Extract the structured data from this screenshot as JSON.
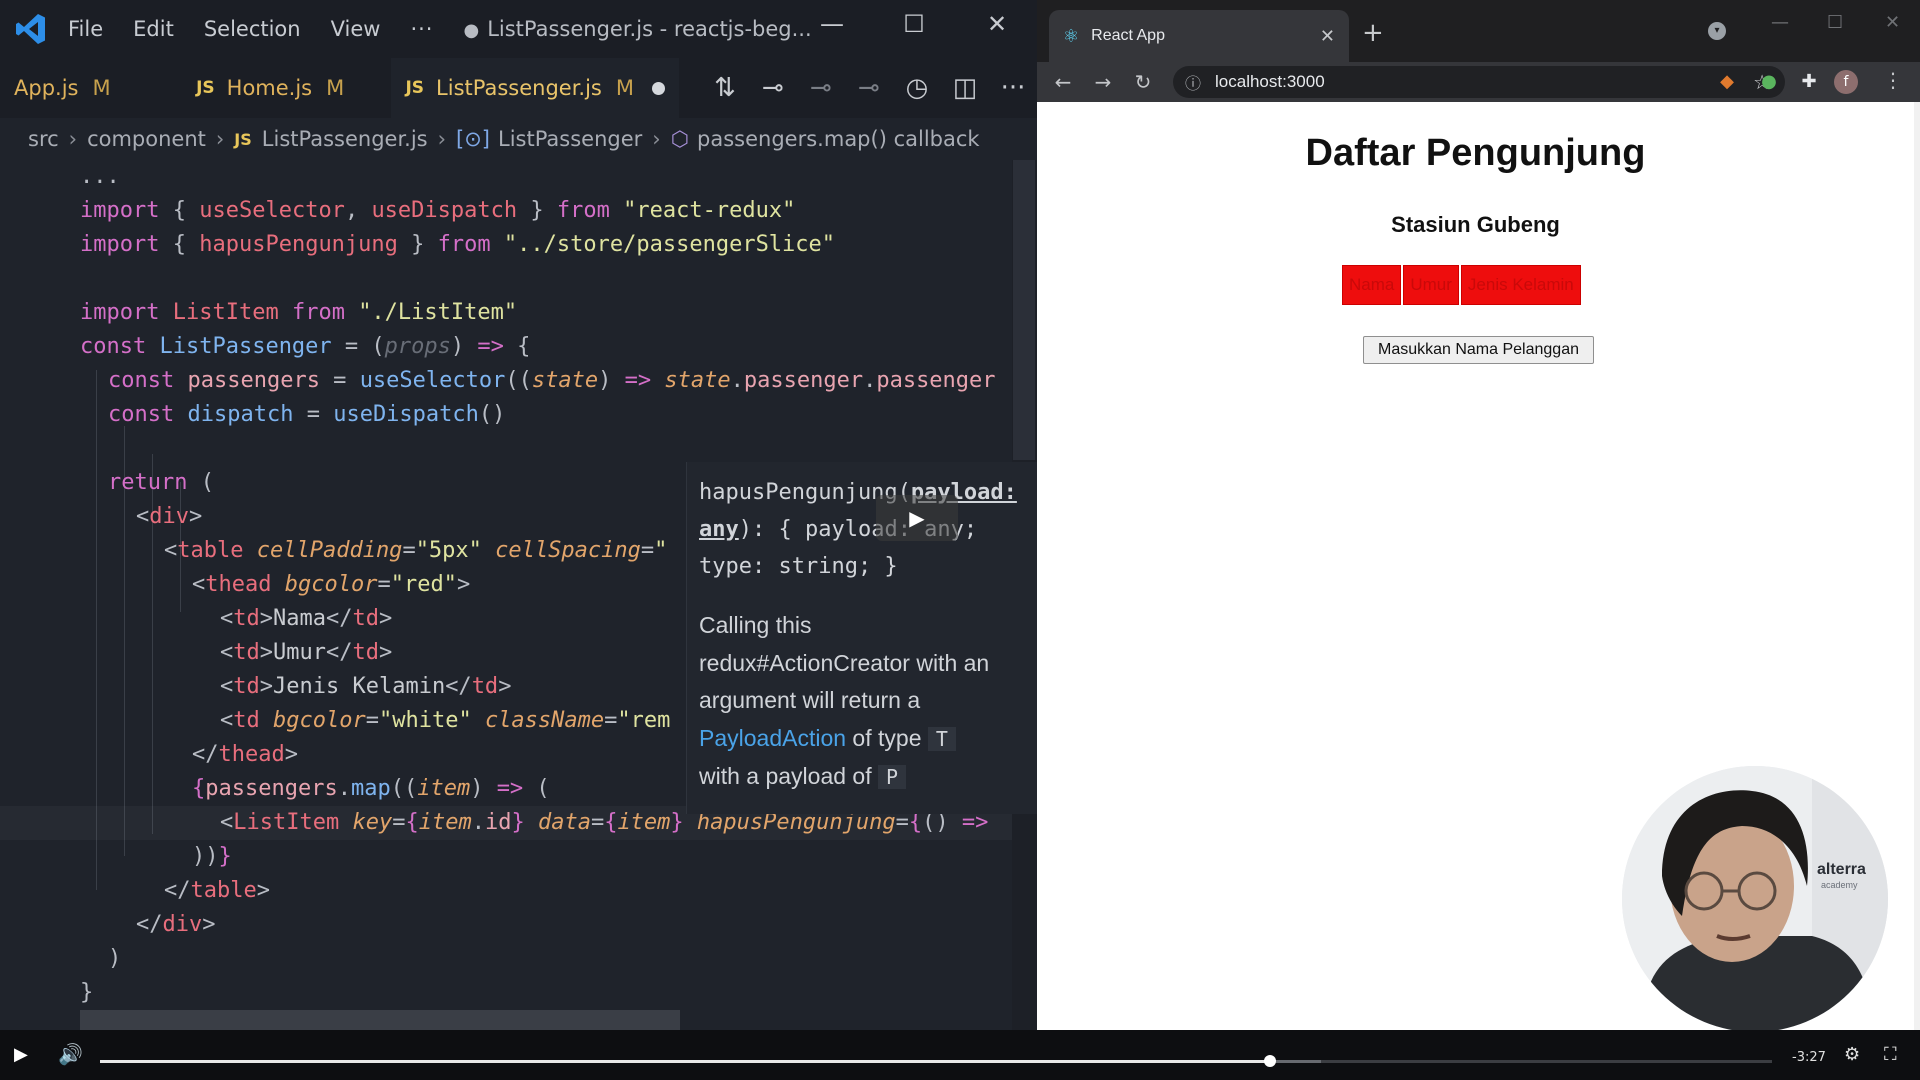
{
  "vscode": {
    "menu": [
      "File",
      "Edit",
      "Selection",
      "View"
    ],
    "menu_more": "···",
    "window_title": "ListPassenger.js - reactjs-beg...",
    "window_controls": {
      "minimize": "—",
      "maximize": "☐",
      "close": "✕"
    },
    "tabs": [
      {
        "label": "App.js",
        "badge": "M",
        "prefix": ""
      },
      {
        "label": "Home.js",
        "badge": "M",
        "prefix": "JS"
      },
      {
        "label": "ListPassenger.js",
        "badge": "M",
        "prefix": "JS"
      }
    ],
    "tab_actions": [
      "source-control-icon",
      "git-commit-icon",
      "go-back-icon",
      "go-forward-icon",
      "timeline-icon",
      "split-editor-icon",
      "more-actions-icon"
    ],
    "breadcrumb": [
      "src",
      "component",
      "ListPassenger.js",
      "ListPassenger",
      "passengers.map() callback"
    ],
    "breadcrumb_js": "JS",
    "code_ellipsis": "...",
    "hover": {
      "sig_name": "hapusPengunjung(",
      "sig_payload": "payload:",
      "sig_any": "any",
      "sig_rest1": "): { payload: any;",
      "sig_rest2": "type: string; }",
      "desc_1": "Calling this",
      "desc_2": "redux#ActionCreator with an",
      "desc_3": "argument will return a",
      "desc_link": "PayloadAction",
      "desc_4": " of type ",
      "desc_T": "T",
      "desc_5": "with a payload of ",
      "desc_P": "P"
    }
  },
  "browser": {
    "tab_title": "React App",
    "url": "localhost:3000",
    "new_tab": "+",
    "page": {
      "title": "Daftar Pengunjung",
      "subtitle": "Stasiun Gubeng",
      "table_headers": [
        "Nama",
        "Umur",
        "Jenis Kelamin"
      ],
      "button_label": "Masukkan Nama Pelanggan"
    },
    "avatar_letter": "f"
  },
  "webcam": {
    "brand": "alterra",
    "brand_sub": "academy"
  },
  "video": {
    "time": "-3:27",
    "progress": 0.7,
    "buffered": 0.73
  },
  "colors": {
    "editor_bg": "#1f232b",
    "keyword": "#d46fc8",
    "variable": "#e86e7d",
    "string": "#dfe3a0",
    "function": "#7fb4ef",
    "table_header_bg": "#ee0d0d"
  }
}
